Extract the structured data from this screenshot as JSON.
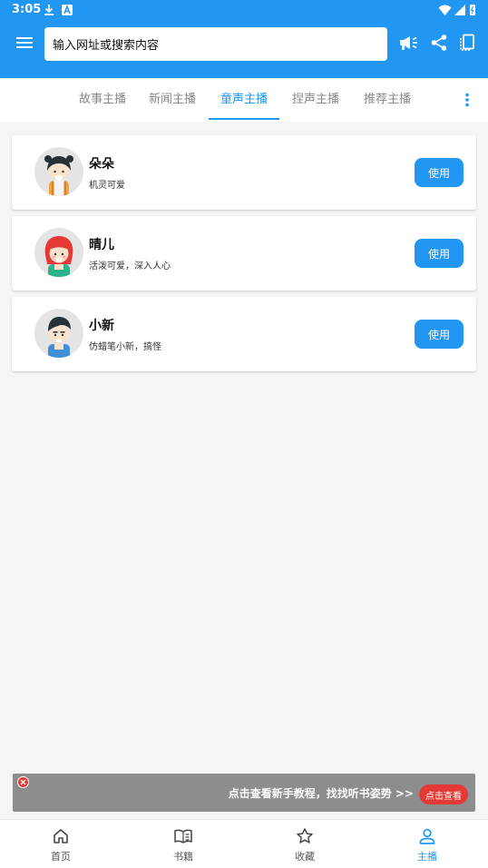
{
  "status_bar": {
    "time": "3:05"
  },
  "toolbar": {
    "menu_icon": "menu-icon",
    "search_placeholder": "输入网址或搜索内容",
    "actions": [
      "megaphone-icon",
      "share-icon",
      "rotate-screen-icon"
    ]
  },
  "tabs": {
    "items": [
      "故事主播",
      "新闻主播",
      "童声主播",
      "捏声主播",
      "推荐主播"
    ],
    "active_index": 2,
    "more_icon": "more-vert-icon"
  },
  "anchors": [
    {
      "name": "朵朵",
      "desc": "机灵可爱",
      "button": "使用"
    },
    {
      "name": "晴儿",
      "desc": "活泼可爱，深入人心",
      "button": "使用"
    },
    {
      "name": "小新",
      "desc": "仿蜡笔小新，搞怪",
      "button": "使用"
    }
  ],
  "banner": {
    "message": "点击查看新手教程，找找听书姿势 >>",
    "button": "点击查看"
  },
  "bottom_nav": [
    {
      "label": "首页",
      "icon": "home-icon"
    },
    {
      "label": "书籍",
      "icon": "book-icon"
    },
    {
      "label": "收藏",
      "icon": "star-icon"
    },
    {
      "label": "主播",
      "icon": "person-icon"
    }
  ],
  "colors": {
    "primary": "#2196f3",
    "accent_red": "#e53935",
    "background": "#f5f5f7"
  }
}
